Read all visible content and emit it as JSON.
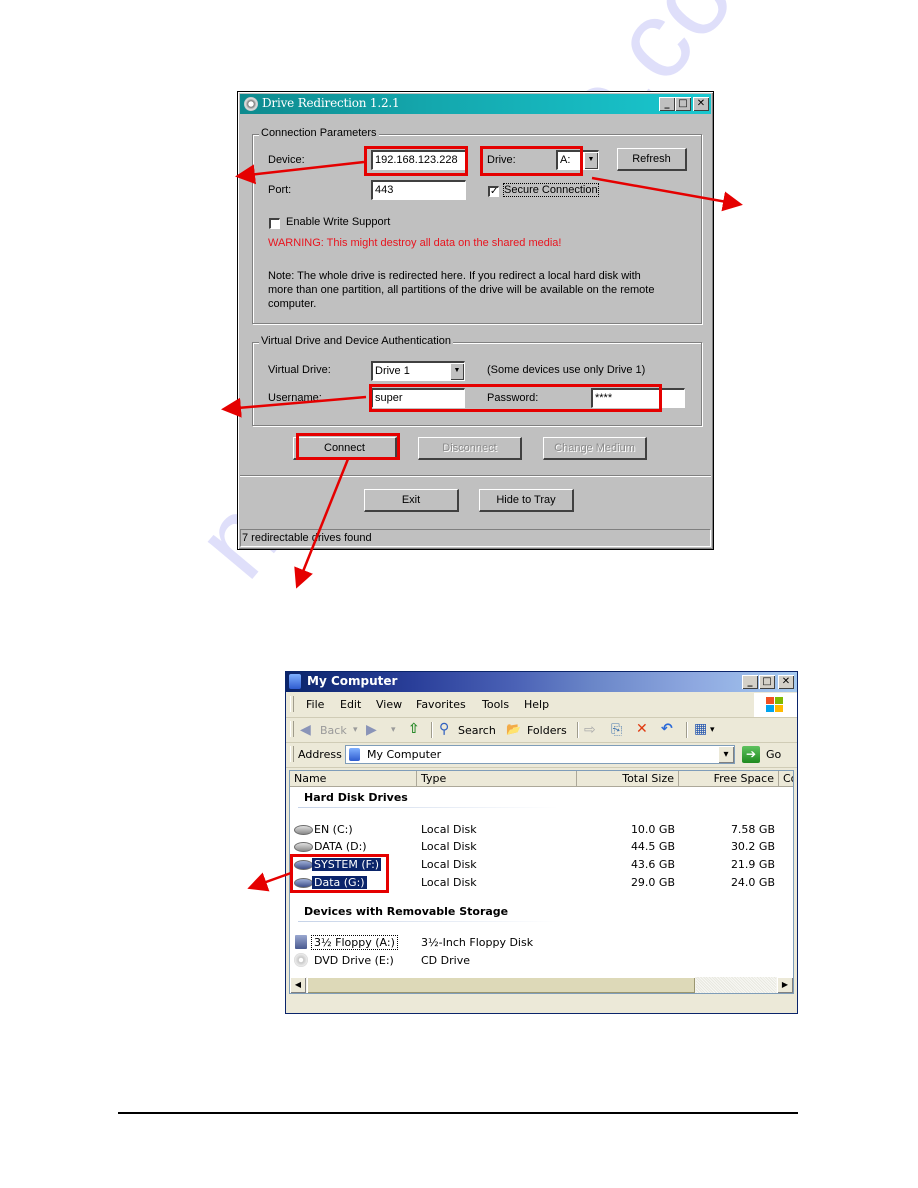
{
  "watermark": "manualshive.com",
  "drive_redirection": {
    "title": "Drive Redirection 1.2.1",
    "title_buttons": {
      "minimize": "_",
      "maximize": "□",
      "close": "✕"
    },
    "connection_parameters": {
      "group_label": "Connection Parameters",
      "device_label": "Device:",
      "device_value": "192.168.123.228",
      "drive_label": "Drive:",
      "drive_value": "A:",
      "refresh_button": "Refresh",
      "port_label": "Port:",
      "port_value": "443",
      "secure_connection_label": "Secure Connection",
      "secure_connection_checked": true,
      "enable_write_label": "Enable Write Support",
      "enable_write_checked": false,
      "warning": "WARNING: This might destroy all data on the shared media!",
      "note_lines": [
        "Note: The whole drive is redirected here. If you redirect a local hard disk with",
        "more than one partition, all partitions of the drive will be available on the remote",
        "computer."
      ]
    },
    "authentication": {
      "group_label": "Virtual Drive and Device Authentication",
      "virtual_drive_label": "Virtual Drive:",
      "virtual_drive_value": "Drive 1",
      "virtual_drive_hint": "(Some devices use only Drive 1)",
      "username_label": "Username:",
      "username_value": "super",
      "password_label": "Password:",
      "password_value": "****"
    },
    "buttons": {
      "connect": "Connect",
      "disconnect": "Disconnect",
      "change_medium": "Change Medium",
      "exit": "Exit",
      "hide_to_tray": "Hide to Tray"
    },
    "status": "7 redirectable drives found",
    "check_glyph": "✓"
  },
  "my_computer": {
    "title": "My Computer",
    "title_buttons": {
      "minimize": "_",
      "maximize": "□",
      "close": "✕"
    },
    "menu": [
      "File",
      "Edit",
      "View",
      "Favorites",
      "Tools",
      "Help"
    ],
    "toolbar": {
      "back": "Back",
      "search": "Search",
      "folders": "Folders",
      "icons": {
        "back": "◀",
        "forward": "▶",
        "up": "⇧",
        "search": "⚲",
        "folders": "📂",
        "move": "⇨",
        "copy": "⎘",
        "delete": "✕",
        "undo": "↶",
        "views": "▦",
        "dropdown": "▾"
      }
    },
    "address": {
      "label": "Address",
      "value": "My Computer",
      "go": "Go",
      "go_icon": "➔",
      "dropdown_icon": "▾"
    },
    "columns": [
      "Name",
      "Type",
      "Total Size",
      "Free Space",
      "Co"
    ],
    "groups": [
      {
        "title": "Hard Disk Drives",
        "items": [
          {
            "name": "EN (C:)",
            "type": "Local Disk",
            "total": "10.0 GB",
            "free": "7.58 GB",
            "selected": false
          },
          {
            "name": "DATA (D:)",
            "type": "Local Disk",
            "total": "44.5 GB",
            "free": "30.2 GB",
            "selected": false
          },
          {
            "name": "SYSTEM (F:)",
            "type": "Local Disk",
            "total": "43.6 GB",
            "free": "21.9 GB",
            "selected": true
          },
          {
            "name": "Data (G:)",
            "type": "Local Disk",
            "total": "29.0 GB",
            "free": "24.0 GB",
            "selected": true
          }
        ]
      },
      {
        "title": "Devices with Removable Storage",
        "items": [
          {
            "name": "3½ Floppy (A:)",
            "type": "3½-Inch Floppy Disk",
            "total": "",
            "free": "",
            "focused": true
          },
          {
            "name": "DVD Drive (E:)",
            "type": "CD Drive",
            "total": "",
            "free": ""
          }
        ]
      }
    ],
    "scroll_icons": {
      "left": "◀",
      "right": "▶"
    }
  },
  "annotation_color": "#e50000"
}
